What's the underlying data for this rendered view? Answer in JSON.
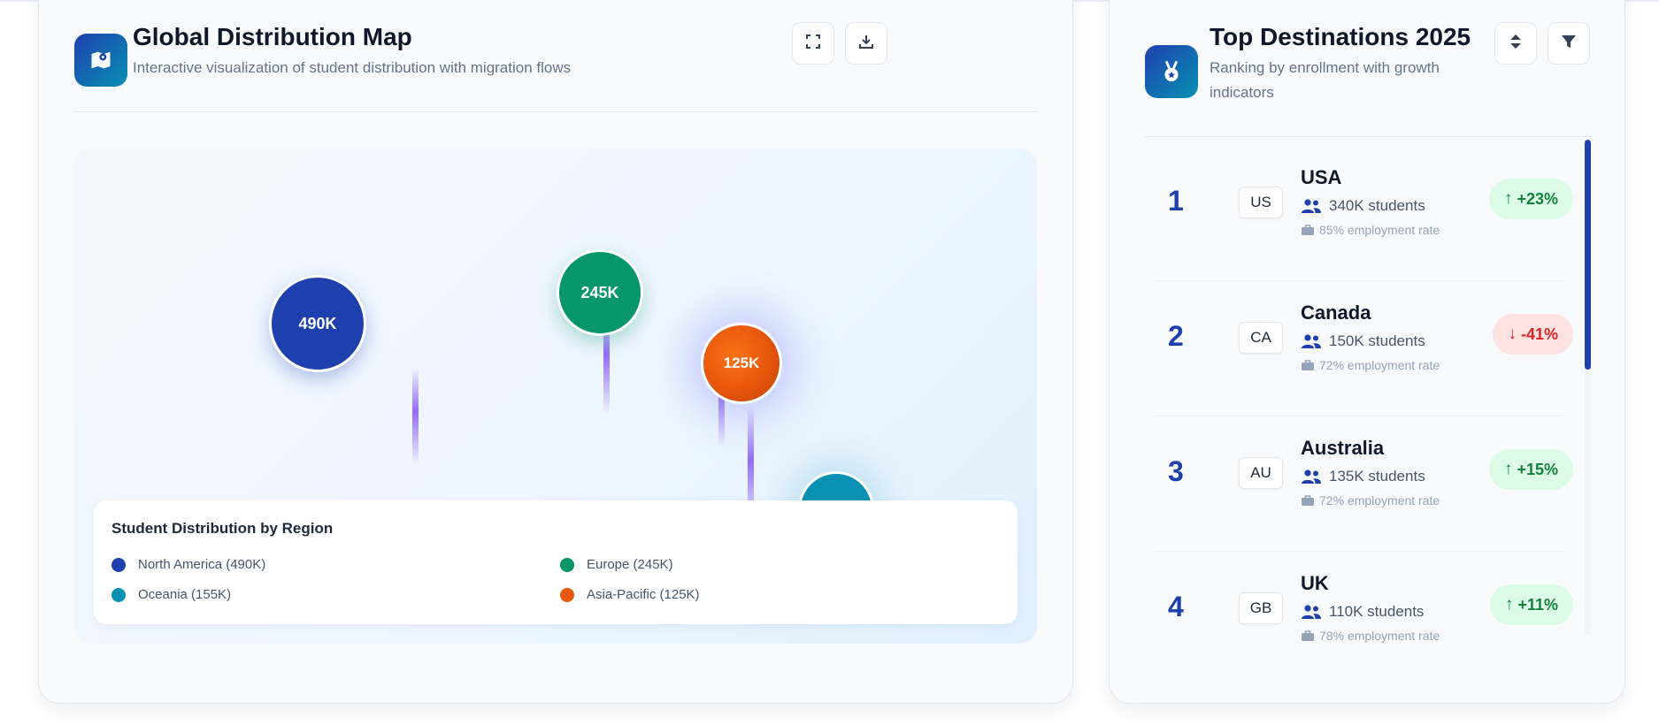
{
  "colors": {
    "north_america": "#1e40af",
    "europe": "#059669",
    "asia_pacific": "#ea580c",
    "oceania": "#0891b2",
    "flow": "#8b5cf6",
    "growth_up": "#15803d",
    "growth_down": "#dc2626"
  },
  "map_panel": {
    "icon": "map-marker-icon",
    "title": "Global Distribution Map",
    "subtitle": "Interactive visualization of student distribution with migration flows",
    "actions": [
      {
        "icon": "fullscreen-icon"
      },
      {
        "icon": "download-icon"
      }
    ],
    "bubbles": [
      {
        "region": "North America",
        "label": "490K",
        "value": 490
      },
      {
        "region": "Europe",
        "label": "245K",
        "value": 245
      },
      {
        "region": "Asia-Pacific",
        "label": "125K",
        "value": 125
      },
      {
        "region": "Oceania",
        "label": "",
        "value": 155
      }
    ],
    "legend": {
      "title": "Student Distribution by Region",
      "items": [
        {
          "label": "North America (490K)",
          "color": "#1e40af"
        },
        {
          "label": "Europe (245K)",
          "color": "#059669"
        },
        {
          "label": "Oceania (155K)",
          "color": "#0891b2"
        },
        {
          "label": "Asia-Pacific (125K)",
          "color": "#ea580c"
        }
      ]
    }
  },
  "destinations_panel": {
    "icon": "medal-icon",
    "title": "Top Destinations 2025",
    "subtitle": "Ranking by enrollment with growth indicators",
    "actions": [
      {
        "icon": "sort-icon"
      },
      {
        "icon": "filter-icon"
      }
    ],
    "items": [
      {
        "rank": "1",
        "code": "US",
        "country": "USA",
        "students": "340K students",
        "employment": "85% employment rate",
        "growth": "+23%",
        "direction": "up"
      },
      {
        "rank": "2",
        "code": "CA",
        "country": "Canada",
        "students": "150K students",
        "employment": "72% employment rate",
        "growth": "-41%",
        "direction": "down"
      },
      {
        "rank": "3",
        "code": "AU",
        "country": "Australia",
        "students": "135K students",
        "employment": "72% employment rate",
        "growth": "+15%",
        "direction": "up"
      },
      {
        "rank": "4",
        "code": "GB",
        "country": "UK",
        "students": "110K students",
        "employment": "78% employment rate",
        "growth": "+11%",
        "direction": "up"
      }
    ]
  }
}
